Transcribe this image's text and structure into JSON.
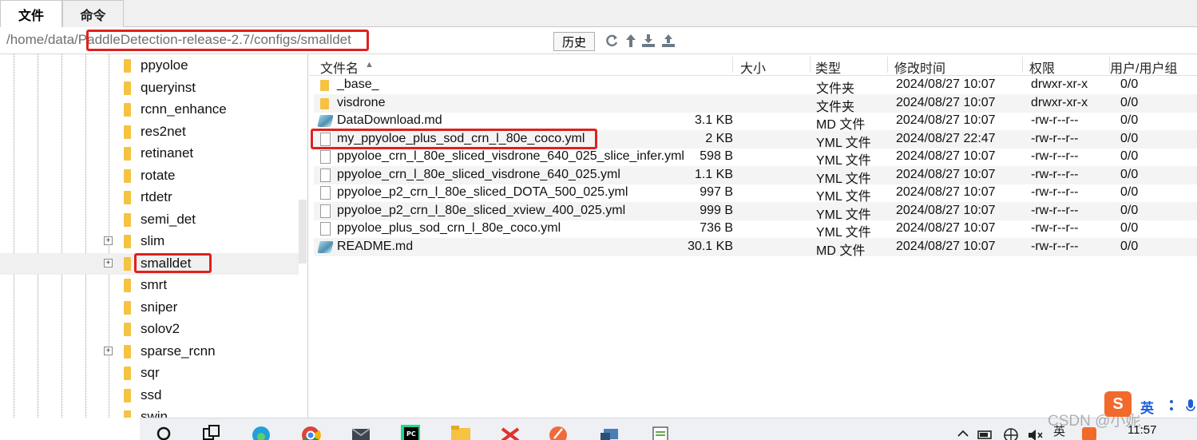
{
  "tabs": [
    {
      "label": "文件"
    },
    {
      "label": "命令"
    }
  ],
  "pathbar": {
    "path": "/home/data/PaddleDetection-release-2.7/configs/smalldet",
    "history_label": "历史"
  },
  "icons": {
    "refresh": "refresh-icon",
    "up": "arrow-up-icon",
    "download": "download-icon",
    "upload": "upload-icon"
  },
  "tree": {
    "items": [
      {
        "label": "ppyoloe",
        "expandable": false,
        "selected": false
      },
      {
        "label": "queryinst",
        "expandable": false,
        "selected": false
      },
      {
        "label": "rcnn_enhance",
        "expandable": false,
        "selected": false
      },
      {
        "label": "res2net",
        "expandable": false,
        "selected": false
      },
      {
        "label": "retinanet",
        "expandable": false,
        "selected": false
      },
      {
        "label": "rotate",
        "expandable": false,
        "selected": false
      },
      {
        "label": "rtdetr",
        "expandable": false,
        "selected": false
      },
      {
        "label": "semi_det",
        "expandable": false,
        "selected": false
      },
      {
        "label": "slim",
        "expandable": true,
        "selected": false
      },
      {
        "label": "smalldet",
        "expandable": true,
        "selected": true
      },
      {
        "label": "smrt",
        "expandable": false,
        "selected": false
      },
      {
        "label": "sniper",
        "expandable": false,
        "selected": false
      },
      {
        "label": "solov2",
        "expandable": false,
        "selected": false
      },
      {
        "label": "sparse_rcnn",
        "expandable": true,
        "selected": false
      },
      {
        "label": "sqr",
        "expandable": false,
        "selected": false
      },
      {
        "label": "ssd",
        "expandable": false,
        "selected": false
      },
      {
        "label": "swin",
        "expandable": false,
        "selected": false
      }
    ],
    "expander_glyph": "+"
  },
  "filelist": {
    "columns": {
      "name": "文件名",
      "sort_glyph": "▲",
      "size": "大小",
      "type": "类型",
      "mtime": "修改时间",
      "perm": "权限",
      "owner": "用户/用户组"
    },
    "rows": [
      {
        "icon": "folder",
        "name": "_base_",
        "size": "",
        "type": "文件夹",
        "mtime": "2024/08/27 10:07",
        "perm": "drwxr-xr-x",
        "owner": "0/0"
      },
      {
        "icon": "folder",
        "name": "visdrone",
        "size": "",
        "type": "文件夹",
        "mtime": "2024/08/27 10:07",
        "perm": "drwxr-xr-x",
        "owner": "0/0"
      },
      {
        "icon": "md",
        "name": "DataDownload.md",
        "size": "3.1 KB",
        "type": "MD 文件",
        "mtime": "2024/08/27 10:07",
        "perm": "-rw-r--r--",
        "owner": "0/0"
      },
      {
        "icon": "file",
        "name": "my_ppyoloe_plus_sod_crn_l_80e_coco.yml",
        "size": "2 KB",
        "type": "YML 文件",
        "mtime": "2024/08/27 22:47",
        "perm": "-rw-r--r--",
        "owner": "0/0"
      },
      {
        "icon": "file",
        "name": "ppyoloe_crn_l_80e_sliced_visdrone_640_025_slice_infer.yml",
        "size": "598 B",
        "type": "YML 文件",
        "mtime": "2024/08/27 10:07",
        "perm": "-rw-r--r--",
        "owner": "0/0"
      },
      {
        "icon": "file",
        "name": "ppyoloe_crn_l_80e_sliced_visdrone_640_025.yml",
        "size": "1.1 KB",
        "type": "YML 文件",
        "mtime": "2024/08/27 10:07",
        "perm": "-rw-r--r--",
        "owner": "0/0"
      },
      {
        "icon": "file",
        "name": "ppyoloe_p2_crn_l_80e_sliced_DOTA_500_025.yml",
        "size": "997 B",
        "type": "YML 文件",
        "mtime": "2024/08/27 10:07",
        "perm": "-rw-r--r--",
        "owner": "0/0"
      },
      {
        "icon": "file",
        "name": "ppyoloe_p2_crn_l_80e_sliced_xview_400_025.yml",
        "size": "999 B",
        "type": "YML 文件",
        "mtime": "2024/08/27 10:07",
        "perm": "-rw-r--r--",
        "owner": "0/0"
      },
      {
        "icon": "file",
        "name": "ppyoloe_plus_sod_crn_l_80e_coco.yml",
        "size": "736 B",
        "type": "YML 文件",
        "mtime": "2024/08/27 10:07",
        "perm": "-rw-r--r--",
        "owner": "0/0"
      },
      {
        "icon": "md",
        "name": "README.md",
        "size": "30.1 KB",
        "type": "MD 文件",
        "mtime": "2024/08/27 10:07",
        "perm": "-rw-r--r--",
        "owner": "0/0"
      }
    ]
  },
  "system_tray": {
    "ime_lang": "英",
    "ime_sogou": "S",
    "lang_indicator": "英",
    "clock": "11:57",
    "watermark": "CSDN @小妮_"
  },
  "colors": {
    "highlight_red": "#e02020",
    "folder_yellow": "#f5c242",
    "sogou_orange": "#f26a2b"
  }
}
